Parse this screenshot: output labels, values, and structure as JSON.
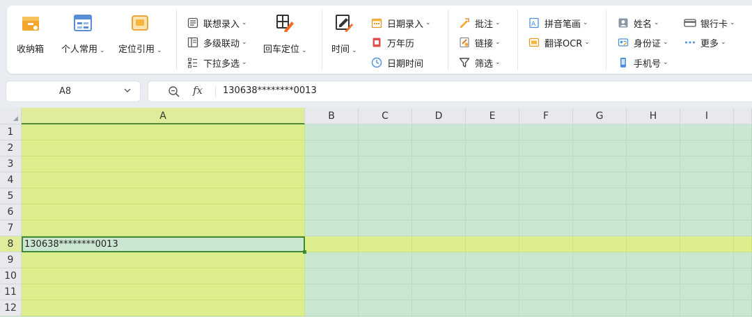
{
  "ribbon": {
    "group1": {
      "shoucang": "收纳箱",
      "personal": "个人常用",
      "locate": "定位引用"
    },
    "group2": {
      "lianxiang": "联想录入",
      "duoji": "多级联动",
      "xiala": "下拉多选",
      "huiche": "回车定位"
    },
    "group3": {
      "time": "时间",
      "date_input": "日期录入",
      "calendar": "万年历",
      "datetime": "日期时间"
    },
    "group4": {
      "annotate": "批注",
      "link": "链接",
      "filter": "筛选"
    },
    "group5": {
      "pinyin": "拼音笔画",
      "ocr": "翻译OCR"
    },
    "group6": {
      "name": "姓名",
      "idcard": "身份证",
      "phone": "手机号"
    },
    "group7": {
      "bankcard": "银行卡",
      "more": "更多"
    }
  },
  "formula_bar": {
    "cell_ref": "A8",
    "fx": "fx",
    "value": "130638********0013"
  },
  "sheet": {
    "columns": [
      "A",
      "B",
      "C",
      "D",
      "E",
      "F",
      "G",
      "H",
      "I"
    ],
    "rows": [
      "1",
      "2",
      "3",
      "4",
      "5",
      "6",
      "7",
      "8",
      "9",
      "10",
      "11",
      "12"
    ],
    "active_cell": "A8",
    "a8_value": "130638********0013"
  },
  "colors": {
    "selected_highlight": "#dcee8e",
    "grid_background": "#cbe7d2",
    "active_border": "#3e8a33"
  }
}
